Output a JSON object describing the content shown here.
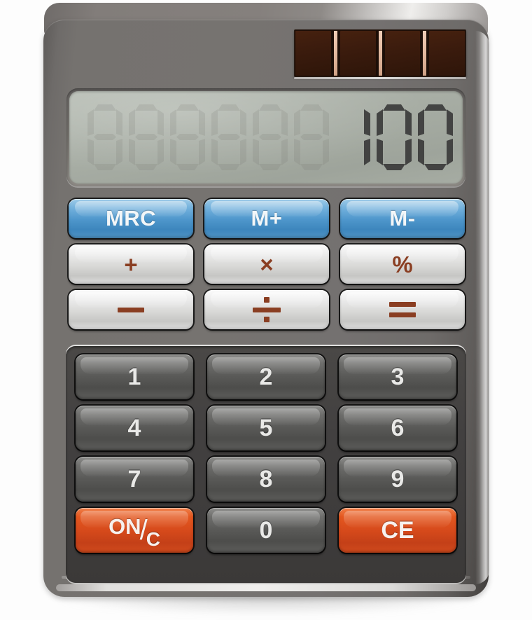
{
  "device": {
    "name": "desktop-calculator",
    "body_color": "#767370",
    "accent_blue": "#4f97cc",
    "accent_orange": "#d5491b",
    "glyph_brown": "#8a3e22"
  },
  "solar_panel": {
    "name": "solar-panel",
    "cell_count": 4,
    "cell_color": "#3a1b0d",
    "separator_color": "#e8c4ae"
  },
  "display": {
    "name": "lcd-display",
    "value": "100",
    "digit_capacity": 9,
    "background_color": "#a9afa6",
    "segment_color": "#3b3b3b",
    "ghost_segment_color": "#6d7369"
  },
  "memory_row": {
    "buttons": [
      {
        "label": "MRC",
        "name": "mrc-button"
      },
      {
        "label": "M+",
        "name": "memory-add-button"
      },
      {
        "label": "M-",
        "name": "memory-subtract-button"
      }
    ]
  },
  "operator_rows": [
    {
      "buttons": [
        {
          "label": "+",
          "name": "plus-button",
          "glyph": "plus"
        },
        {
          "label": "×",
          "name": "multiply-button",
          "glyph": "times"
        },
        {
          "label": "%",
          "name": "percent-button",
          "glyph": "percent"
        }
      ]
    },
    {
      "buttons": [
        {
          "label": "−",
          "name": "minus-button",
          "glyph": "minus"
        },
        {
          "label": "÷",
          "name": "divide-button",
          "glyph": "divide"
        },
        {
          "label": "=",
          "name": "equals-button",
          "glyph": "equals"
        }
      ]
    }
  ],
  "keypad": {
    "rows": [
      [
        {
          "label": "1",
          "name": "key-1"
        },
        {
          "label": "2",
          "name": "key-2"
        },
        {
          "label": "3",
          "name": "key-3"
        }
      ],
      [
        {
          "label": "4",
          "name": "key-4"
        },
        {
          "label": "5",
          "name": "key-5"
        },
        {
          "label": "6",
          "name": "key-6"
        }
      ],
      [
        {
          "label": "7",
          "name": "key-7"
        },
        {
          "label": "8",
          "name": "key-8"
        },
        {
          "label": "9",
          "name": "key-9"
        }
      ]
    ],
    "bottom_row": {
      "on_clear": {
        "name": "on-clear-button",
        "part_on": "ON",
        "part_slash": "/",
        "part_c": "C",
        "full_label": "ON/C"
      },
      "zero": {
        "label": "0",
        "name": "key-0"
      },
      "clear_entry": {
        "label": "CE",
        "name": "clear-entry-button"
      }
    }
  }
}
